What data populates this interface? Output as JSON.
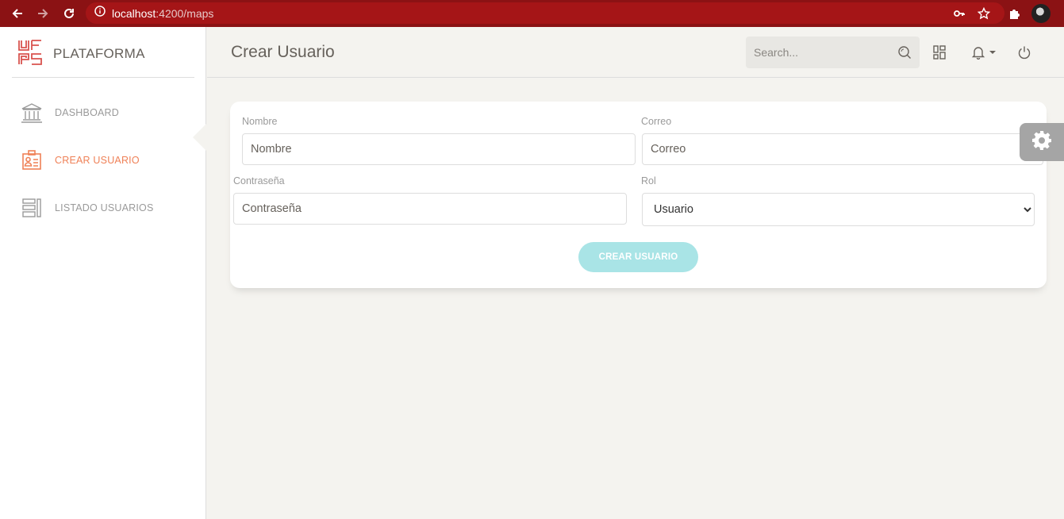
{
  "browser": {
    "url_host": "localhost",
    "url_path": ":4200/maps"
  },
  "sidebar": {
    "brand": "PLATAFORMA",
    "items": [
      {
        "label": "DASHBOARD",
        "icon": "bank-icon",
        "active": false
      },
      {
        "label": "CREAR USUARIO",
        "icon": "id-badge-icon",
        "active": true
      },
      {
        "label": "LISTADO USUARIOS",
        "icon": "list-icon",
        "active": false
      }
    ]
  },
  "header": {
    "title": "Crear Usuario",
    "search_placeholder": "Search..."
  },
  "form": {
    "nombre_label": "Nombre",
    "nombre_placeholder": "Nombre",
    "correo_label": "Correo",
    "correo_placeholder": "Correo",
    "password_label": "Contraseña",
    "password_placeholder": "Contraseña",
    "rol_label": "Rol",
    "rol_selected": "Usuario",
    "submit_label": "CREAR USUARIO"
  },
  "colors": {
    "browser_bar": "#8b1214",
    "accent_active": "#ef8157",
    "button_bg": "#a9e4e6",
    "page_bg": "#f4f3ef"
  }
}
